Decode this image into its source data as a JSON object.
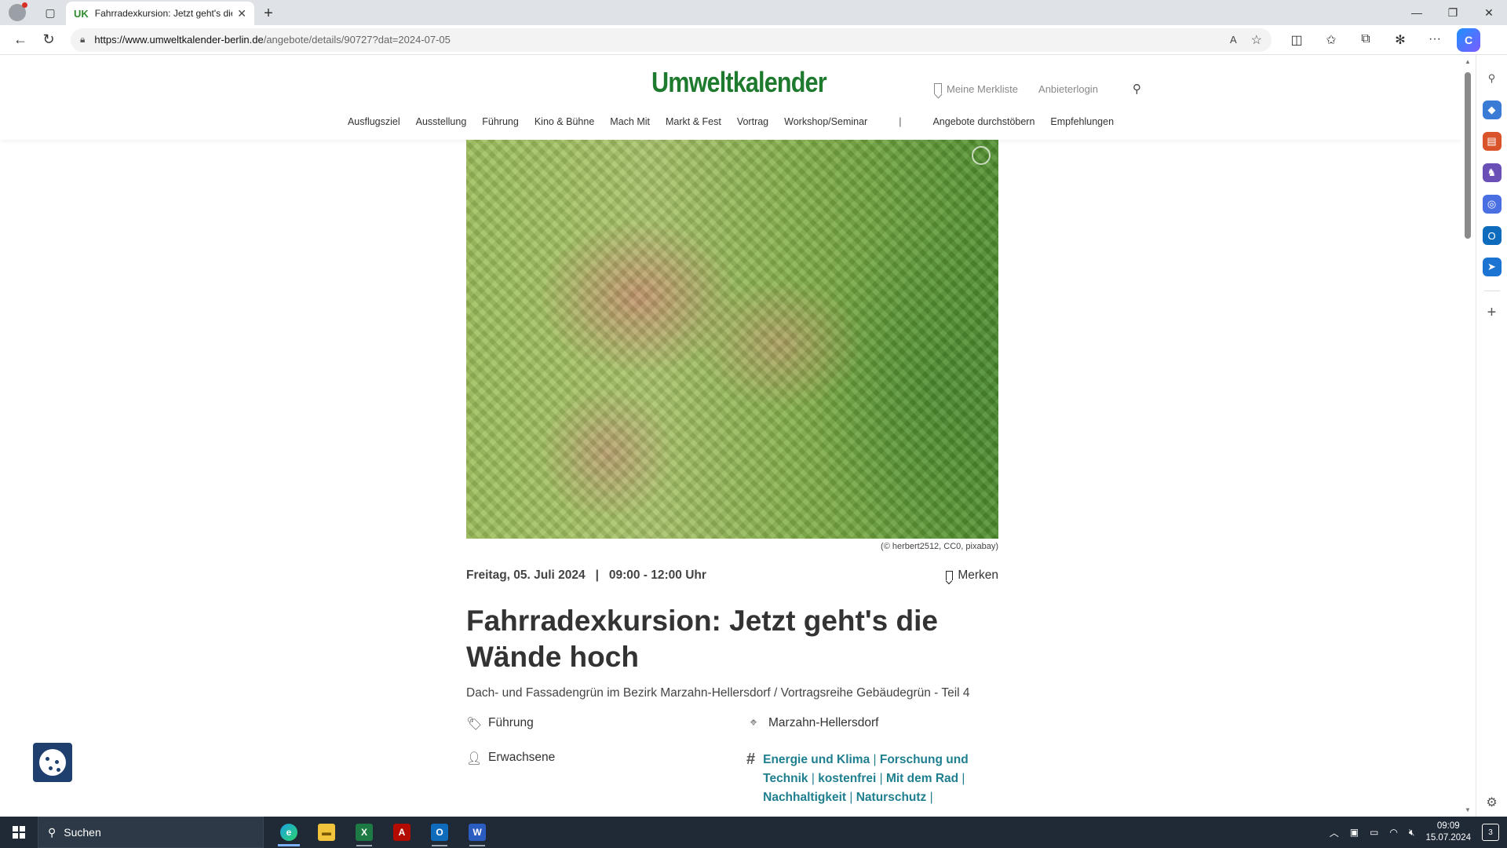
{
  "browser": {
    "tab_title": "Fahrradexkursion: Jetzt geht's die Wände hoch",
    "tab_favicon": "UK",
    "url_host": "https://www.umweltkalender-berlin.de",
    "url_path": "/angebote/details/90727?dat=2024-07-05"
  },
  "site": {
    "logo": "Umweltkalender",
    "header_links": {
      "merkliste": "Meine Merkliste",
      "login": "Anbieterlogin"
    },
    "nav": [
      "Ausflugsziel",
      "Ausstellung",
      "Führung",
      "Kino & Bühne",
      "Mach Mit",
      "Markt & Fest",
      "Vortrag",
      "Workshop/Seminar"
    ],
    "nav_separator": "|",
    "nav_right": [
      "Angebote durchstöbern",
      "Empfehlungen"
    ]
  },
  "event": {
    "image_credit": "(© herbert2512, CC0, pixabay)",
    "date": "Freitag, 05. Juli 2024",
    "date_separator": "|",
    "time": "09:00 - 12:00 Uhr",
    "bookmark_label": "Merken",
    "title": "Fahrradexkursion: Jetzt geht's die Wände hoch",
    "subtitle": "Dach- und Fassadengrün im Bezirk Marzahn-Hellersdorf / Vortragsreihe Gebäudegrün - Teil 4",
    "category": "Führung",
    "location": "Marzahn-Hellersdorf",
    "audience": "Erwachsene",
    "tags": [
      "Energie und Klima",
      "Forschung und Technik",
      "kostenfrei",
      "Mit dem Rad",
      "Nachhaltigkeit",
      "Naturschutz"
    ],
    "tag_separator": "|"
  },
  "taskbar": {
    "search_label": "Suchen",
    "time": "09:09",
    "date": "15.07.2024",
    "notification_count": "3"
  },
  "colors": {
    "logo_green": "#1e7a2e",
    "tag_teal": "#1f7f8f",
    "taskbar_bg": "#1f2a36",
    "cookie_blue": "#1f3f6f"
  }
}
